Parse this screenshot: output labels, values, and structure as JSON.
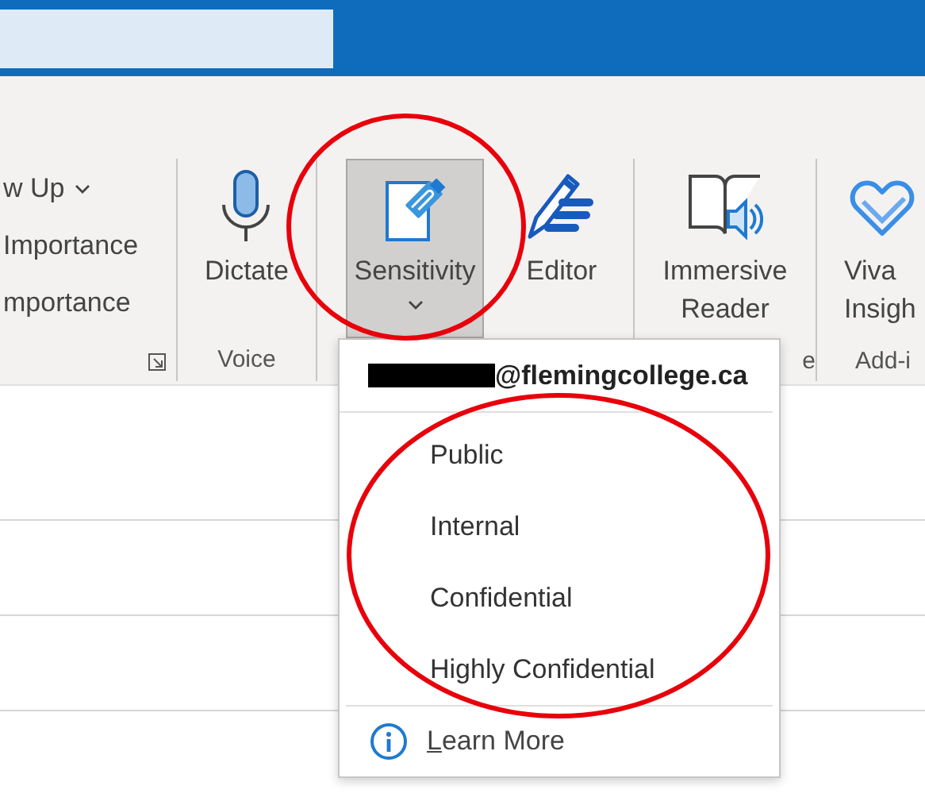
{
  "ribbon": {
    "groups": [
      {
        "kind": "commands",
        "launcher": true,
        "commands": [
          {
            "label": "w Up",
            "has_menu": true
          },
          {
            "label": "Importance",
            "has_menu": false
          },
          {
            "label": "mportance",
            "has_menu": false
          }
        ]
      },
      {
        "kind": "buttons",
        "label": "Voice",
        "buttons": [
          {
            "label": "Dictate",
            "pressed": false,
            "has_menu": false
          }
        ]
      },
      {
        "kind": "buttons",
        "buttons": [
          {
            "label": "Sensitivity",
            "pressed": true,
            "has_menu": true
          },
          {
            "label": "Editor",
            "pressed": false,
            "has_menu": false
          }
        ]
      },
      {
        "kind": "buttons",
        "label": "e",
        "buttons": [
          {
            "label": "Immersive Reader",
            "pressed": false,
            "has_menu": false
          }
        ]
      },
      {
        "kind": "buttons",
        "label": "Add-i",
        "buttons": [
          {
            "label": "Viva Insigh",
            "pressed": false,
            "has_menu": false
          }
        ]
      }
    ]
  },
  "sensitivity_menu": {
    "account": "@flemingcollege.ca",
    "account_redacted": true,
    "labels": [
      {
        "label": "Public"
      },
      {
        "label": "Internal"
      },
      {
        "label": "Confidential"
      },
      {
        "label": "Highly Confidential"
      }
    ],
    "footer": {
      "label": "Learn More"
    }
  }
}
